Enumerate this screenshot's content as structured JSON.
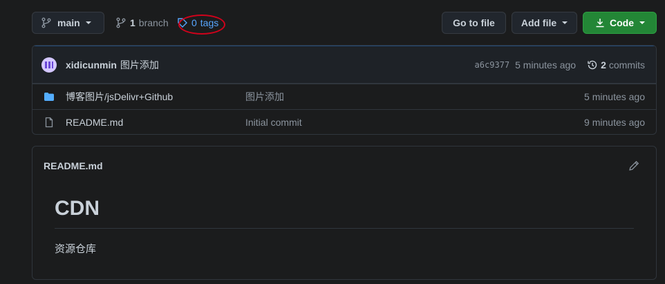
{
  "toolbar": {
    "branch_label": "main",
    "branch_count": "1",
    "branch_text": "branch",
    "tag_count": "0",
    "tag_text": "tags",
    "goto_label": "Go to file",
    "addfile_label": "Add file",
    "code_label": "Code"
  },
  "commit": {
    "author": "xidicunmin",
    "message": "图片添加",
    "sha": "a6c9377",
    "age": "5 minutes ago",
    "commit_count": "2",
    "commit_text": "commits"
  },
  "files": [
    {
      "name": "博客图片/jsDelivr+Github",
      "commit": "图片添加",
      "age": "5 minutes ago",
      "type": "folder"
    },
    {
      "name": "README.md",
      "commit": "Initial commit",
      "age": "9 minutes ago",
      "type": "file"
    }
  ],
  "readme": {
    "title": "README.md",
    "h1": "CDN",
    "paragraph": "资源仓库"
  },
  "colors": {
    "accent": "#58a6ff",
    "code_button": "#238636",
    "annotation": "#d0021b"
  }
}
